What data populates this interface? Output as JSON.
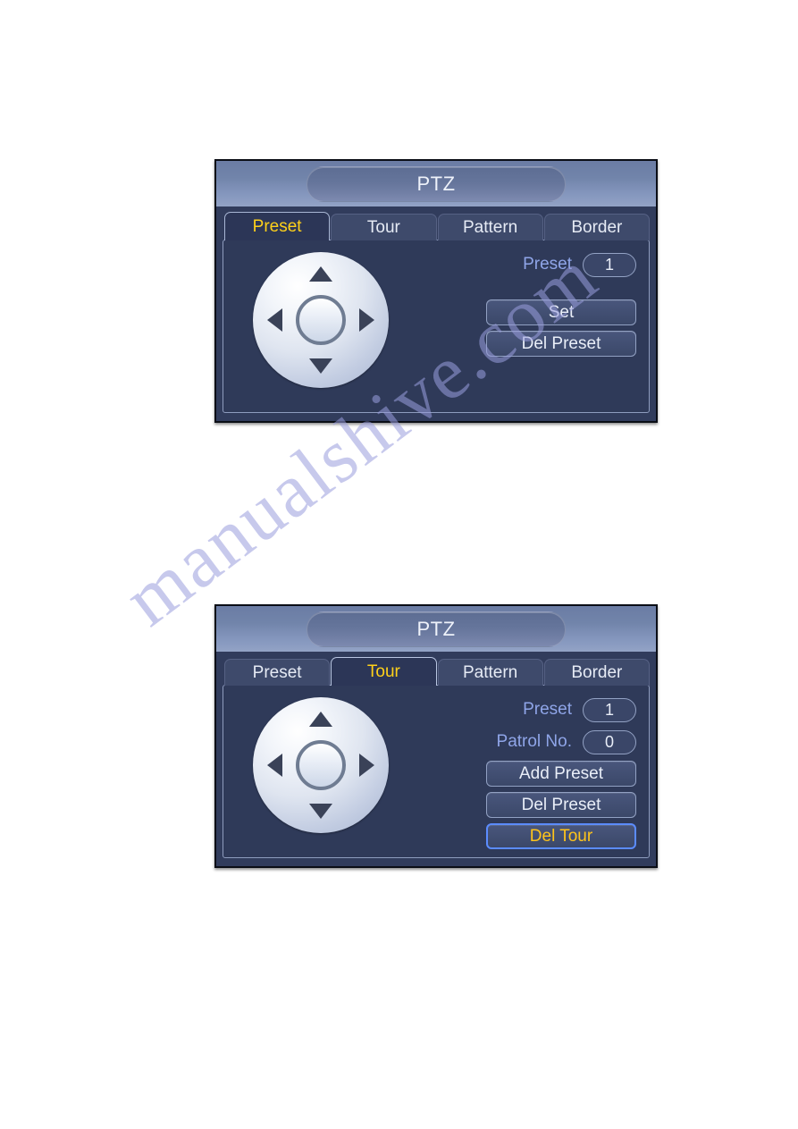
{
  "page": {
    "background": "#ffffff",
    "watermark": "manualshive.com",
    "watermark_color": "#9a9ede"
  },
  "theme": {
    "dialog_bg": "#313c5c",
    "panel_bg": "#2f3a59",
    "titlebar_top": "#6b7ca4",
    "titlebar_bottom": "#93a3c6",
    "tab_inactive_bg": "#3e4a6b",
    "tab_active_bg": "#2c3657",
    "accent_yellow": "#ffd11a",
    "label_blue": "#8fa5e8",
    "text_light": "#e9eef8",
    "focus_blue": "#5b8cff"
  },
  "dialogs": [
    {
      "id": "preset",
      "title": "PTZ",
      "tabs": [
        {
          "label": "Preset",
          "active": true
        },
        {
          "label": "Tour",
          "active": false
        },
        {
          "label": "Pattern",
          "active": false
        },
        {
          "label": "Border",
          "active": false
        }
      ],
      "joystick": {
        "up_icon": "triangle-up-icon",
        "down_icon": "triangle-down-icon",
        "left_icon": "triangle-left-icon",
        "right_icon": "triangle-right-icon",
        "center_icon": "joystick-center-ring-icon"
      },
      "fields": [
        {
          "label": "Preset",
          "value": "1"
        }
      ],
      "buttons": [
        {
          "label": "Set",
          "focused": false
        },
        {
          "label": "Del Preset",
          "focused": false
        }
      ]
    },
    {
      "id": "tour",
      "title": "PTZ",
      "tabs": [
        {
          "label": "Preset",
          "active": false
        },
        {
          "label": "Tour",
          "active": true
        },
        {
          "label": "Pattern",
          "active": false
        },
        {
          "label": "Border",
          "active": false
        }
      ],
      "joystick": {
        "up_icon": "triangle-up-icon",
        "down_icon": "triangle-down-icon",
        "left_icon": "triangle-left-icon",
        "right_icon": "triangle-right-icon",
        "center_icon": "joystick-center-ring-icon"
      },
      "fields": [
        {
          "label": "Preset",
          "value": "1"
        },
        {
          "label": "Patrol No.",
          "value": "0"
        }
      ],
      "buttons": [
        {
          "label": "Add Preset",
          "focused": false
        },
        {
          "label": "Del Preset",
          "focused": false
        },
        {
          "label": "Del Tour",
          "focused": true
        }
      ]
    }
  ]
}
